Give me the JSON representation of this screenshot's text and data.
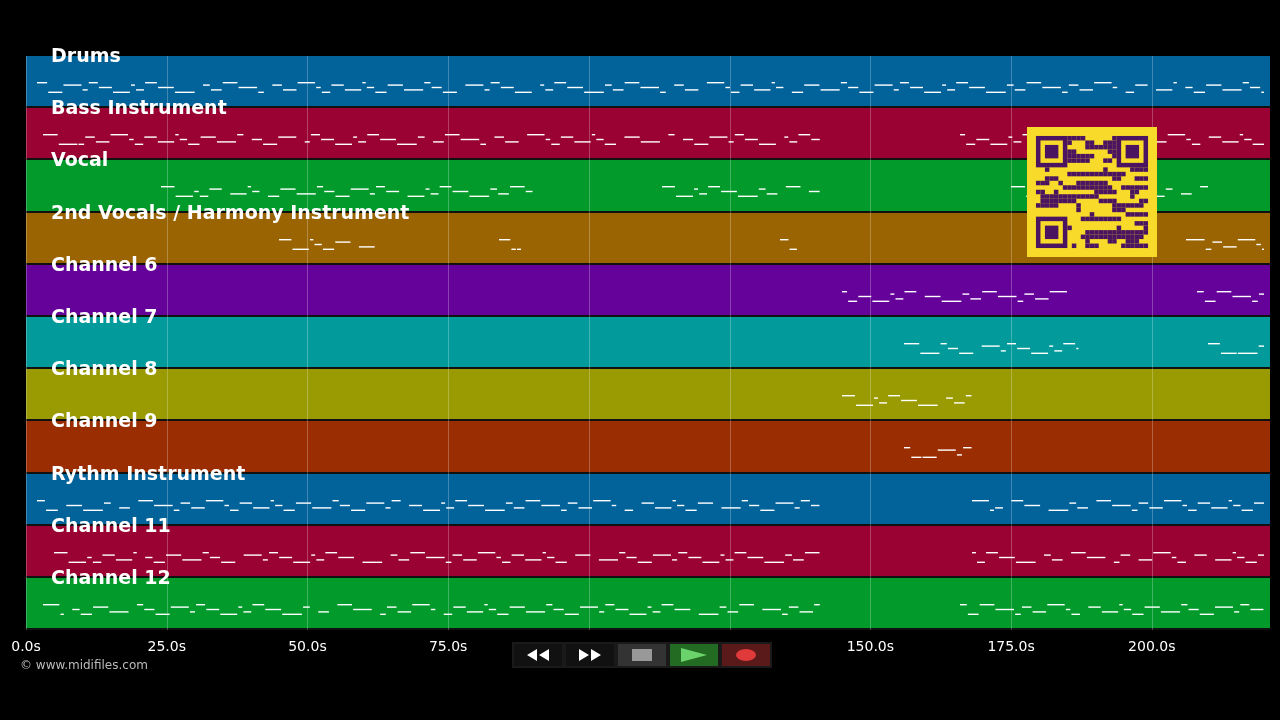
{
  "tracks": [
    {
      "name": "Drums",
      "color": "#02629a"
    },
    {
      "name": "Bass Instrument",
      "color": "#9a0233"
    },
    {
      "name": "Vocal",
      "color": "#029a2b"
    },
    {
      "name": "2nd Vocals / Harmony Instrument",
      "color": "#9a6402"
    },
    {
      "name": "Channel 6",
      "color": "#650299"
    },
    {
      "name": "Channel 7",
      "color": "#029a9a"
    },
    {
      "name": "Channel 8",
      "color": "#9a9a02"
    },
    {
      "name": "Channel 9",
      "color": "#9a2e02"
    },
    {
      "name": "Rythm Instrument",
      "color": "#02629a"
    },
    {
      "name": "Channel 11",
      "color": "#9a0233"
    },
    {
      "name": "Channel 12",
      "color": "#029a2b"
    }
  ],
  "time_axis": [
    {
      "label": "0.0s"
    },
    {
      "label": "25.0s"
    },
    {
      "label": "50.0s"
    },
    {
      "label": "75.0s"
    },
    {
      "label": "150.0s"
    },
    {
      "label": "175.0s"
    },
    {
      "label": "200.0s"
    }
  ],
  "copyright": "© www.midifiles.com",
  "transport": [
    {
      "kind": "rewind"
    },
    {
      "kind": "forward"
    },
    {
      "kind": "stop"
    },
    {
      "kind": "play"
    },
    {
      "kind": "record"
    }
  ]
}
